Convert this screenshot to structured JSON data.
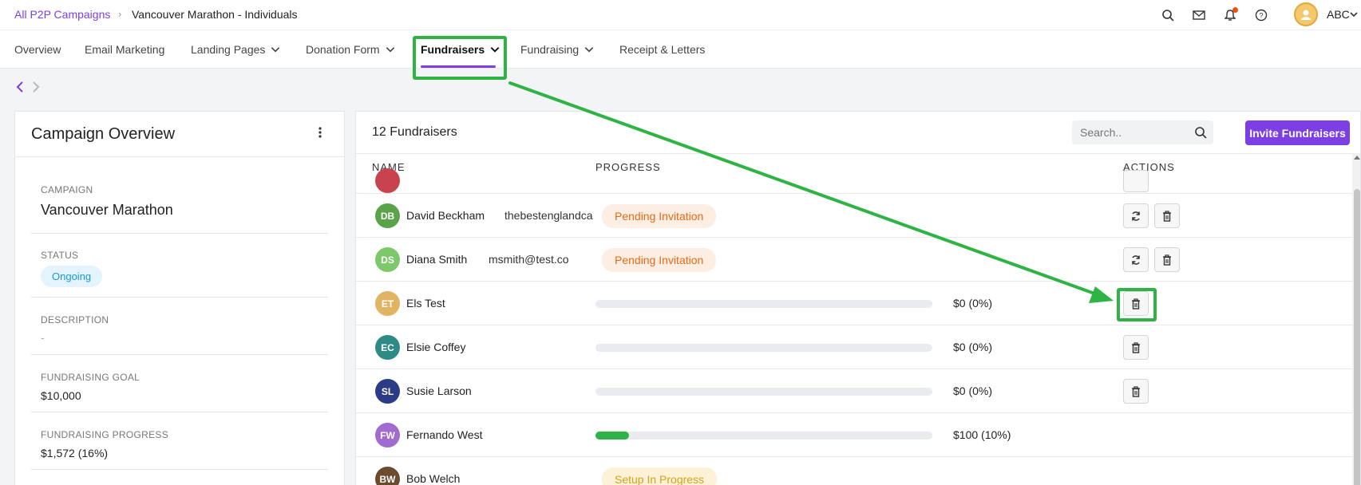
{
  "breadcrumb": {
    "parent": "All P2P Campaigns",
    "current": "Vancouver Marathon - Individuals"
  },
  "user": {
    "name": "ABC"
  },
  "tabs": [
    {
      "label": "Overview",
      "has_dropdown": false
    },
    {
      "label": "Email Marketing",
      "has_dropdown": false
    },
    {
      "label": "Landing Pages",
      "has_dropdown": true
    },
    {
      "label": "Donation Form",
      "has_dropdown": true
    },
    {
      "label": "Fundraisers",
      "has_dropdown": true,
      "active": true
    },
    {
      "label": "Fundraising",
      "has_dropdown": true
    },
    {
      "label": "Receipt & Letters",
      "has_dropdown": false
    }
  ],
  "overview": {
    "title": "Campaign Overview",
    "campaign_label": "CAMPAIGN",
    "campaign_value": "Vancouver Marathon",
    "status_label": "STATUS",
    "status_value": "Ongoing",
    "description_label": "DESCRIPTION",
    "description_value": "-",
    "goal_label": "FUNDRAISING GOAL",
    "goal_value": "$10,000",
    "progress_label": "FUNDRAISING PROGRESS",
    "progress_value": "$1,572 (16%)"
  },
  "fundraisers": {
    "title": "12 Fundraisers",
    "search_placeholder": "Search..",
    "invite_label": "Invite Fundraisers",
    "columns": {
      "name": "NAME",
      "progress": "PROGRESS",
      "actions": "ACTIONS"
    },
    "rows": [
      {
        "initials": "DB",
        "name": "David Beckham",
        "email": "thebestenglandca",
        "status": "Pending Invitation",
        "color": "#5aa34a"
      },
      {
        "initials": "DS",
        "name": "Diana Smith",
        "email": "msmith@test.co",
        "status": "Pending Invitation",
        "color": "#7dc86a"
      },
      {
        "initials": "ET",
        "name": "Els Test",
        "amount": "$0 (0%)",
        "progress": 0,
        "color": "#e1b463"
      },
      {
        "initials": "EC",
        "name": "Elsie Coffey",
        "amount": "$0 (0%)",
        "progress": 0,
        "color": "#2e8a84"
      },
      {
        "initials": "SL",
        "name": "Susie Larson",
        "amount": "$0 (0%)",
        "progress": 0,
        "color": "#2c3b86"
      },
      {
        "initials": "FW",
        "name": "Fernando West",
        "amount": "$100 (10%)",
        "progress": 0.1,
        "color": "#a26bd0"
      },
      {
        "initials": "BW",
        "name": "Bob Welch",
        "status": "Setup In Progress",
        "color": "#6b4a2e"
      }
    ]
  },
  "colors": {
    "accent": "#7b3fe4",
    "annotation": "#2fb344",
    "pending": "#e56a16",
    "progress": "#2eb347"
  }
}
